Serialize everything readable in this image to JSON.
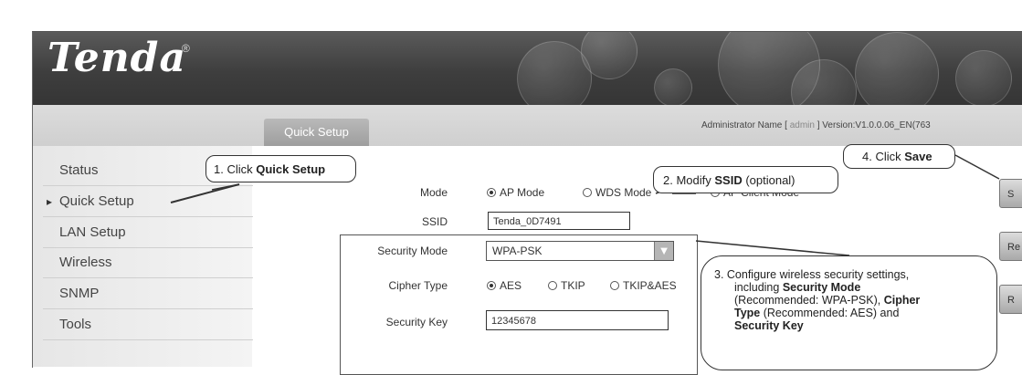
{
  "brand": {
    "logo_text": "Tenda",
    "logo_mark": "®"
  },
  "header": {
    "tab_label": "Quick Setup",
    "admin_prefix": "Administrator Name [",
    "admin_name": "admin",
    "admin_suffix": "] Version:V1.0.0.06_EN(763"
  },
  "sidebar": {
    "items": [
      {
        "label": "Status"
      },
      {
        "label": "Quick Setup"
      },
      {
        "label": "LAN Setup"
      },
      {
        "label": "Wireless"
      },
      {
        "label": "SNMP"
      },
      {
        "label": "Tools"
      }
    ]
  },
  "form": {
    "mode_label": "Mode",
    "mode_options": [
      "AP Mode",
      "WDS Mode",
      "AP Client Mode"
    ],
    "mode_selected": "AP Mode",
    "ssid_label": "SSID",
    "ssid_value": "Tenda_0D7491",
    "security_mode_label": "Security Mode",
    "security_mode_value": "WPA-PSK",
    "cipher_label": "Cipher Type",
    "cipher_options": [
      "AES",
      "TKIP",
      "TKIP&AES"
    ],
    "cipher_selected": "AES",
    "key_label": "Security Key",
    "key_value": "12345678"
  },
  "side_buttons": [
    {
      "label": "S"
    },
    {
      "label": "Re"
    },
    {
      "label": "R"
    }
  ],
  "callouts": {
    "c1_prefix": "1. Click ",
    "c1_bold": "Quick Setup",
    "c2_prefix": "2. Modify ",
    "c2_bold": "SSID",
    "c2_suffix": " (optional)",
    "c4_prefix": "4. Click ",
    "c4_bold": "Save",
    "c3_line1": "3. Configure wireless security settings,",
    "c3_line2_prefix": "including ",
    "c3_line2_bold": "Security Mode",
    "c3_line3": "(Recommended: WPA-PSK), ",
    "c3_line3_bold": "Cipher",
    "c3_line4_bold": "Type",
    "c3_line4": " (Recommended: AES) and",
    "c3_line5_bold": "Security Key"
  }
}
